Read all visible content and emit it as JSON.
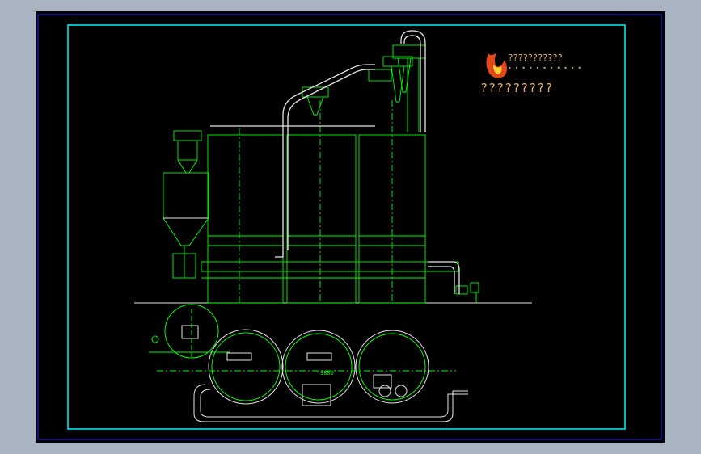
{
  "viewer": {
    "background_color": "#a9b3c1",
    "viewport_color": "#000000",
    "frame_color": "#00e5ee",
    "line_color": "#00ff00",
    "pipe_color": "#e6e6e6"
  },
  "title_block": {
    "logo": "flame-logo",
    "title_text": "???????????",
    "title_dots": "• • • • • • • • • • •",
    "subtitle_text": "?????????"
  },
  "annotations": {
    "dimension_label": "3800"
  }
}
